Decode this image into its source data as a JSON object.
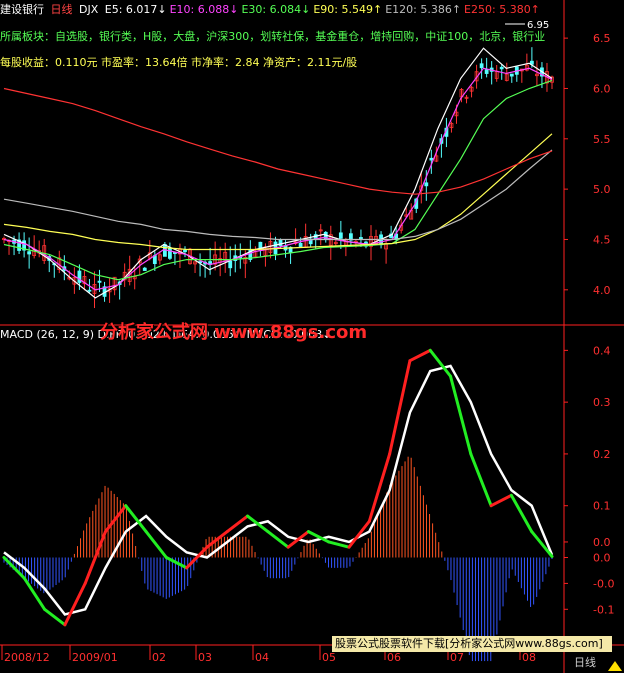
{
  "header": {
    "stock_name": "建设银行",
    "period": "日线",
    "index": "DJX",
    "ma": [
      {
        "label": "E5",
        "value": "6.017",
        "arrow": "↓",
        "color": "#ffffff"
      },
      {
        "label": "E10",
        "value": "6.088",
        "arrow": "↓",
        "color": "#ff44ff"
      },
      {
        "label": "E30",
        "value": "6.084",
        "arrow": "↓",
        "color": "#55ff55"
      },
      {
        "label": "E90",
        "value": "5.549",
        "arrow": "↑",
        "color": "#ffff55"
      },
      {
        "label": "E120",
        "value": "5.386",
        "arrow": "↑",
        "color": "#bbbbbb"
      },
      {
        "label": "E250",
        "value": "5.380",
        "arrow": "↑",
        "color": "#ff3333"
      }
    ]
  },
  "sector_line": "所属板块：自选股，银行类，H股，大盘，沪深300，划转社保，基金重仓，增持回购，中证100，北京，银行业",
  "finance_line": "每股收益：0.110元 市盈率：13.64倍 市净率：2.84 净资产：2.11元/股",
  "watermark_text": "分析家公式网 www.88gs.com",
  "macd_header": "MACD (26, 12, 9)  DIFF: 0.002↓  DEA: 0.005↑  MACD: -0.003↓",
  "banner_text": "股票公式股票软件下载[分析家公式网www.88gs.com]",
  "week_label": "日线",
  "high_label": "6.95",
  "colors": {
    "up": "#ff3333",
    "down": "#55ffff",
    "axis": "#ff2020",
    "diff": "#ff2020",
    "dea": "#ffffff",
    "diff_down": "#22ee22"
  },
  "chart_data": [
    {
      "type": "line",
      "title": "建设银行 日线",
      "ylim": [
        3.7,
        6.7
      ],
      "y_ticks": [
        "6.5",
        "6.0",
        "5.5",
        "5.0",
        "4.5",
        "4.0"
      ],
      "x_ticks": [
        "2008/12",
        "2009/01",
        "02",
        "03",
        "04",
        "05",
        "06",
        "07",
        "08"
      ],
      "series": [
        {
          "name": "E5",
          "values": [
            4.55,
            4.45,
            4.3,
            4.1,
            3.92,
            4.05,
            4.3,
            4.45,
            4.35,
            4.2,
            4.3,
            4.4,
            4.45,
            4.5,
            4.55,
            4.48,
            4.45,
            4.55,
            5.0,
            5.6,
            6.1,
            6.4,
            6.2,
            6.25,
            6.1
          ]
        },
        {
          "name": "E10",
          "values": [
            4.5,
            4.45,
            4.32,
            4.15,
            4.0,
            4.05,
            4.25,
            4.4,
            4.35,
            4.25,
            4.3,
            4.38,
            4.42,
            4.48,
            4.52,
            4.48,
            4.45,
            4.5,
            4.85,
            5.4,
            5.9,
            6.2,
            6.15,
            6.2,
            6.09
          ]
        },
        {
          "name": "E30",
          "values": [
            4.45,
            4.4,
            4.35,
            4.25,
            4.15,
            4.1,
            4.15,
            4.25,
            4.3,
            4.3,
            4.3,
            4.32,
            4.35,
            4.38,
            4.42,
            4.43,
            4.44,
            4.46,
            4.6,
            4.95,
            5.3,
            5.7,
            5.9,
            6.0,
            6.08
          ]
        },
        {
          "name": "E90",
          "values": [
            4.65,
            4.62,
            4.58,
            4.55,
            4.5,
            4.47,
            4.45,
            4.42,
            4.4,
            4.4,
            4.4,
            4.4,
            4.41,
            4.42,
            4.43,
            4.44,
            4.45,
            4.46,
            4.5,
            4.6,
            4.75,
            4.95,
            5.15,
            5.35,
            5.55
          ]
        },
        {
          "name": "E120",
          "values": [
            4.9,
            4.86,
            4.82,
            4.78,
            4.73,
            4.68,
            4.65,
            4.6,
            4.58,
            4.55,
            4.53,
            4.52,
            4.5,
            4.5,
            4.5,
            4.5,
            4.5,
            4.5,
            4.53,
            4.6,
            4.7,
            4.85,
            5.0,
            5.2,
            5.39
          ]
        },
        {
          "name": "E250",
          "values": [
            6.0,
            5.95,
            5.9,
            5.85,
            5.78,
            5.7,
            5.62,
            5.55,
            5.47,
            5.4,
            5.33,
            5.27,
            5.2,
            5.15,
            5.1,
            5.05,
            5.0,
            4.97,
            4.95,
            4.97,
            5.02,
            5.1,
            5.2,
            5.3,
            5.38
          ]
        }
      ]
    },
    {
      "type": "bar",
      "title": "MACD (26, 12, 9)",
      "ylim": [
        -0.14,
        0.42
      ],
      "y_ticks": [
        "0.4",
        "0.3",
        "0.2",
        "0.1",
        "0.0",
        "0.0",
        "-0.0",
        "-0.1"
      ],
      "series": [
        {
          "name": "DIFF",
          "values": [
            0.0,
            -0.04,
            -0.1,
            -0.13,
            -0.05,
            0.05,
            0.1,
            0.05,
            0.0,
            -0.02,
            0.02,
            0.05,
            0.08,
            0.05,
            0.02,
            0.05,
            0.03,
            0.02,
            0.07,
            0.2,
            0.38,
            0.4,
            0.35,
            0.2,
            0.1,
            0.12,
            0.05,
            0.002
          ]
        },
        {
          "name": "DEA",
          "values": [
            0.01,
            -0.02,
            -0.06,
            -0.11,
            -0.1,
            -0.02,
            0.05,
            0.08,
            0.04,
            0.01,
            0.0,
            0.03,
            0.06,
            0.07,
            0.04,
            0.03,
            0.04,
            0.03,
            0.05,
            0.13,
            0.28,
            0.36,
            0.37,
            0.3,
            0.2,
            0.13,
            0.1,
            0.005
          ]
        },
        {
          "name": "MACD",
          "values": [
            -0.01,
            -0.04,
            -0.07,
            -0.04,
            0.06,
            0.14,
            0.1,
            -0.06,
            -0.08,
            -0.06,
            0.04,
            0.04,
            0.04,
            -0.04,
            -0.04,
            0.04,
            -0.02,
            -0.02,
            0.04,
            0.14,
            0.2,
            0.08,
            -0.04,
            -0.2,
            -0.2,
            -0.02,
            -0.1,
            -0.003
          ]
        }
      ]
    }
  ]
}
